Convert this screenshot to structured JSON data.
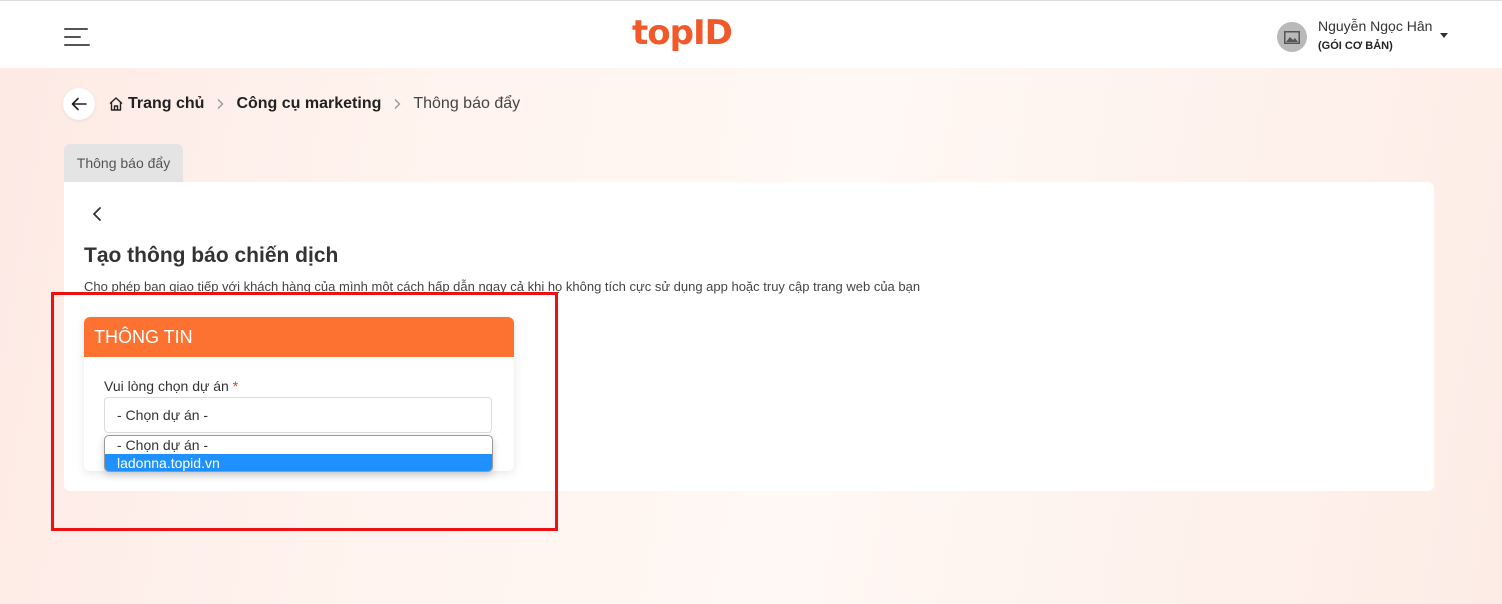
{
  "header": {
    "logo_text": "topID",
    "user": {
      "name": "Nguyễn Ngọc Hân",
      "plan": "(GÓI CƠ BẢN)"
    }
  },
  "breadcrumb": {
    "items": [
      "Trang chủ",
      "Công cụ marketing",
      "Thông báo đẩy"
    ]
  },
  "tabs": [
    {
      "label": "Thông báo đẩy",
      "active": true
    }
  ],
  "page": {
    "title": "Tạo thông báo chiến dịch",
    "description": "Cho phép bạn giao tiếp với khách hàng của mình một cách hấp dẫn ngay cả khi họ không tích cực sử dụng app hoặc truy cập trang web của bạn"
  },
  "info_section": {
    "title": "THÔNG TIN",
    "project_field": {
      "label": "Vui lòng chọn dự án",
      "required_mark": "*",
      "value": "- Chọn dự án -",
      "options": [
        "- Chọn dự án -",
        "ladonna.topid.vn"
      ],
      "highlighted_option": "ladonna.topid.vn"
    }
  },
  "icons": {
    "menu": "hamburger-menu-icon",
    "avatar": "image-placeholder-icon",
    "user_menu": "caret-down-icon",
    "back": "arrow-left-icon",
    "home": "home-icon",
    "separator": "chevron-right-icon",
    "card_back": "chevron-left-icon"
  },
  "colors": {
    "brand": "#f2592a",
    "section_header": "#fd7230",
    "selected_option": "#1e90ff",
    "annotation": "#ee1111"
  }
}
